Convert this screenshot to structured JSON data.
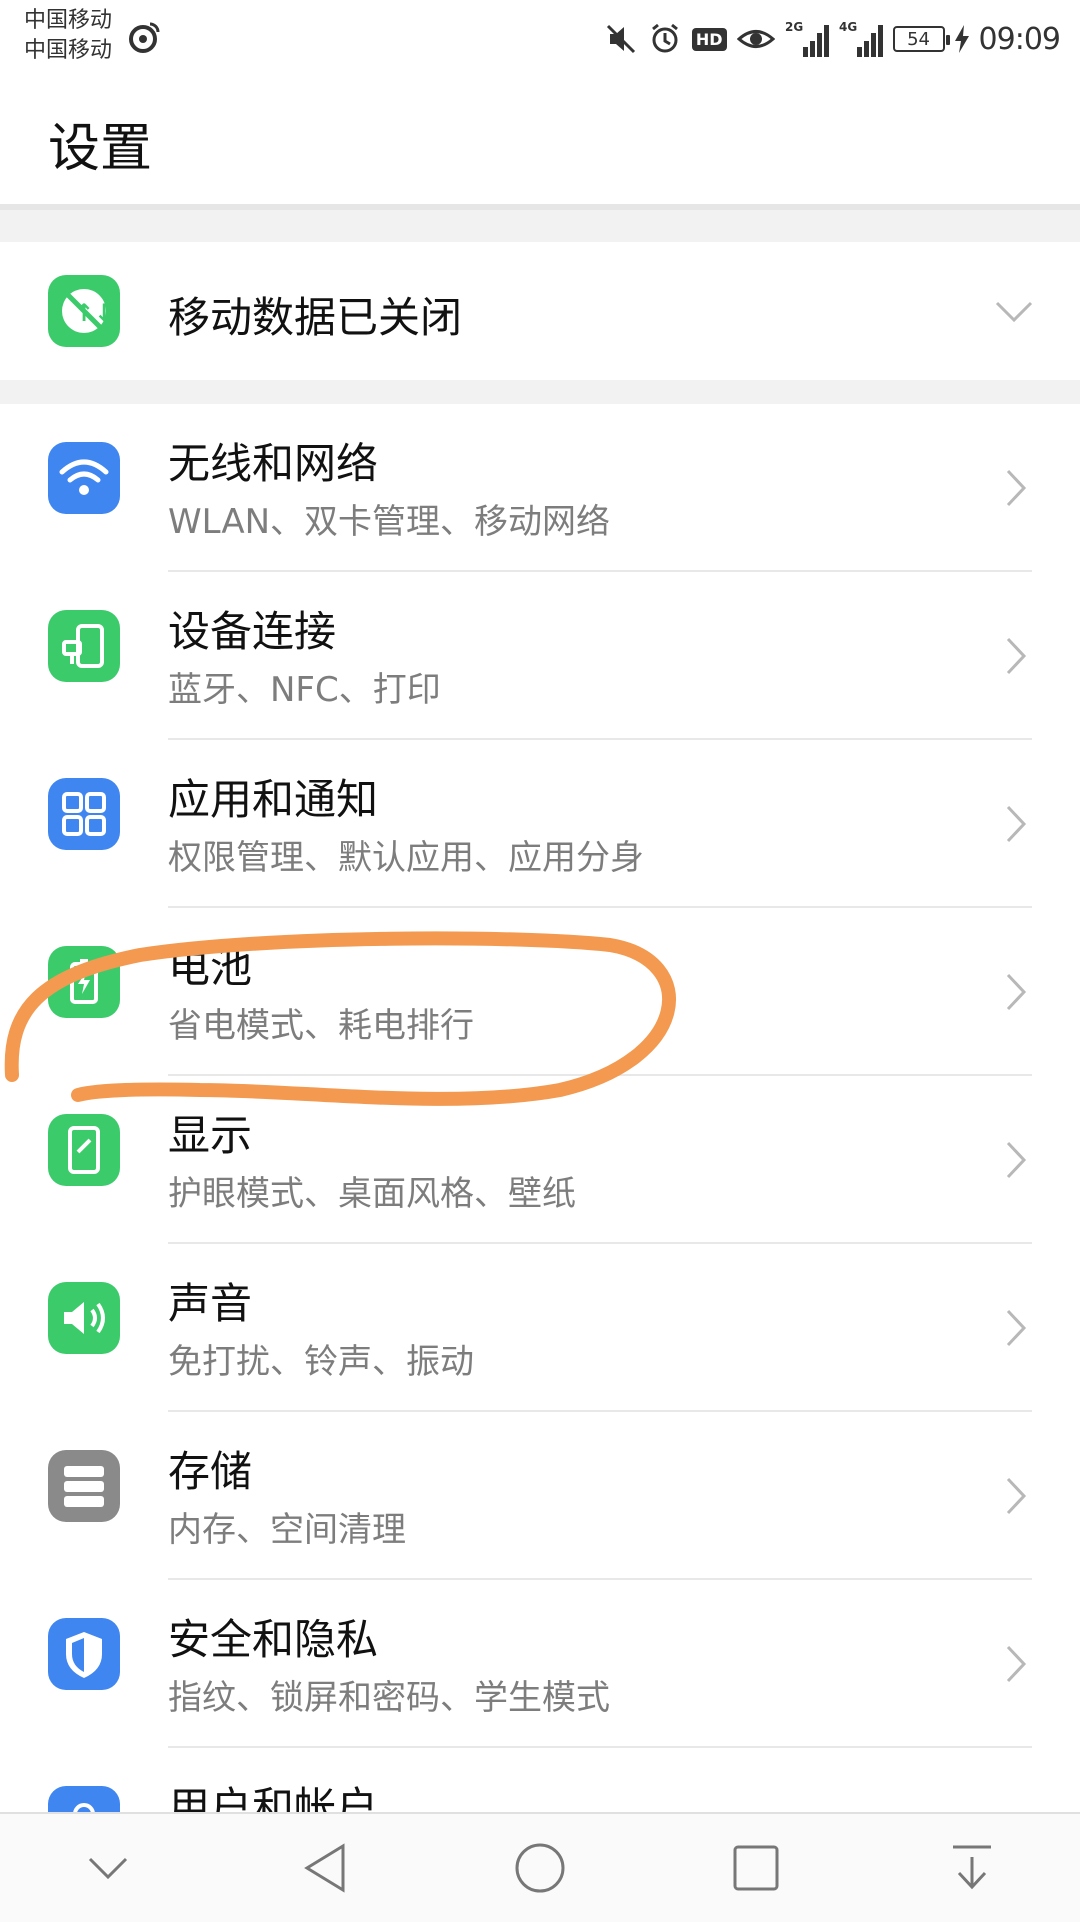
{
  "status_bar": {
    "carrier_1": "中国移动",
    "carrier_2": "中国移动",
    "hd_badge": "HD",
    "net_2g": "2G",
    "net_4g": "4G",
    "battery_level": "54",
    "time": "09:09"
  },
  "header": {
    "title": "设置"
  },
  "mobile_data": {
    "label": "移动数据已关闭",
    "icon": "mobile-data-off-icon",
    "icon_color": "#3ccb6b"
  },
  "settings": [
    {
      "id": "wireless",
      "title": "无线和网络",
      "subtitle": "WLAN、双卡管理、移动网络",
      "icon": "wifi-icon",
      "color": "#3f86f0"
    },
    {
      "id": "device-connection",
      "title": "设备连接",
      "subtitle": "蓝牙、NFC、打印",
      "icon": "device-connection-icon",
      "color": "#3ccb6b"
    },
    {
      "id": "apps-notifications",
      "title": "应用和通知",
      "subtitle": "权限管理、默认应用、应用分身",
      "icon": "apps-grid-icon",
      "color": "#3f86f0"
    },
    {
      "id": "battery",
      "title": "电池",
      "subtitle": "省电模式、耗电排行",
      "icon": "battery-icon",
      "color": "#3ccb6b"
    },
    {
      "id": "display",
      "title": "显示",
      "subtitle": "护眼模式、桌面风格、壁纸",
      "icon": "display-icon",
      "color": "#3ccb6b"
    },
    {
      "id": "sound",
      "title": "声音",
      "subtitle": "免打扰、铃声、振动",
      "icon": "speaker-icon",
      "color": "#3ccb6b"
    },
    {
      "id": "storage",
      "title": "存储",
      "subtitle": "内存、空间清理",
      "icon": "storage-icon",
      "color": "#8a8a8a"
    },
    {
      "id": "security-privacy",
      "title": "安全和隐私",
      "subtitle": "指纹、锁屏和密码、学生模式",
      "icon": "shield-icon",
      "color": "#3f86f0"
    },
    {
      "id": "users-accounts",
      "title": "用户和帐户",
      "subtitle": "",
      "icon": "user-icon",
      "color": "#3f86f0"
    }
  ],
  "colors": {
    "annotation": "#f39a50",
    "chevron": "#b8b8b8"
  }
}
